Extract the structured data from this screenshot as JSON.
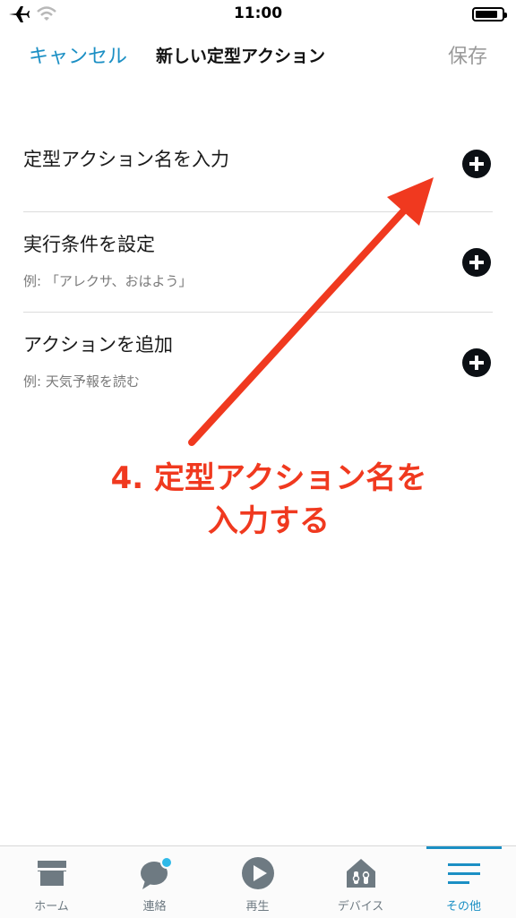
{
  "status_bar": {
    "time": "11:00",
    "airplane_icon": "airplane-icon",
    "wifi_icon": "wifi-icon",
    "battery_icon": "battery-icon",
    "battery_level": 0.85
  },
  "nav": {
    "cancel_label": "キャンセル",
    "title": "新しい定型アクション",
    "save_label": "保存"
  },
  "form": {
    "rows": [
      {
        "label": "定型アクション名を入力",
        "hint": ""
      },
      {
        "label": "実行条件を設定",
        "hint": "例: 「アレクサ、おはよう」"
      },
      {
        "label": "アクションを追加",
        "hint": "例: 天気予報を読む"
      }
    ],
    "add_icon": "plus-circle-icon"
  },
  "annotation": {
    "line1": "4. 定型アクション名を",
    "line2": "入力する",
    "color": "#f0391f"
  },
  "tab_bar": {
    "tabs": [
      {
        "label": "ホーム",
        "icon": "home-icon"
      },
      {
        "label": "連絡",
        "icon": "chat-bubble-icon"
      },
      {
        "label": "再生",
        "icon": "play-icon"
      },
      {
        "label": "デバイス",
        "icon": "devices-icon"
      },
      {
        "label": "その他",
        "icon": "menu-icon"
      }
    ],
    "active_tab": "その他"
  },
  "colors": {
    "accent": "#1b8fc4",
    "annotation": "#f0391f",
    "notification_dot": "#2fb9e8"
  }
}
